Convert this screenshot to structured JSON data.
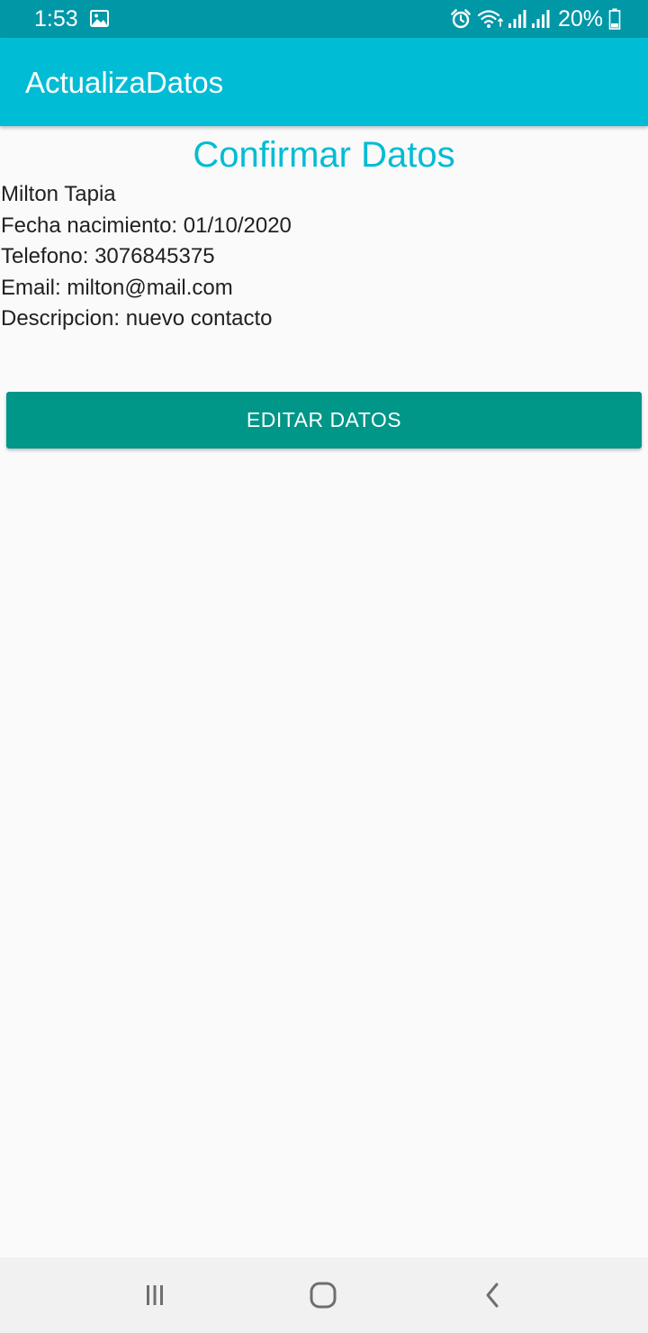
{
  "status_bar": {
    "time": "1:53",
    "battery_percent": "20%",
    "background_color": "#0097a7",
    "icons": [
      "gallery-icon",
      "alarm-icon",
      "wifi-icon",
      "signal-icon",
      "signal-icon",
      "battery-icon"
    ]
  },
  "app_bar": {
    "title": "ActualizaDatos",
    "background_color": "#00bcd4"
  },
  "main": {
    "heading": "Confirmar Datos",
    "heading_color": "#00bcd4",
    "details": [
      "Milton Tapia",
      "Fecha nacimiento: 01/10/2020",
      "Telefono: 3076845375",
      "Email: milton@mail.com",
      "Descripcion: nuevo contacto"
    ],
    "edit_button_label": "EDITAR DATOS",
    "edit_button_color": "#009688"
  },
  "nav_bar": {
    "buttons": [
      "recents-icon",
      "home-icon",
      "back-icon"
    ]
  }
}
